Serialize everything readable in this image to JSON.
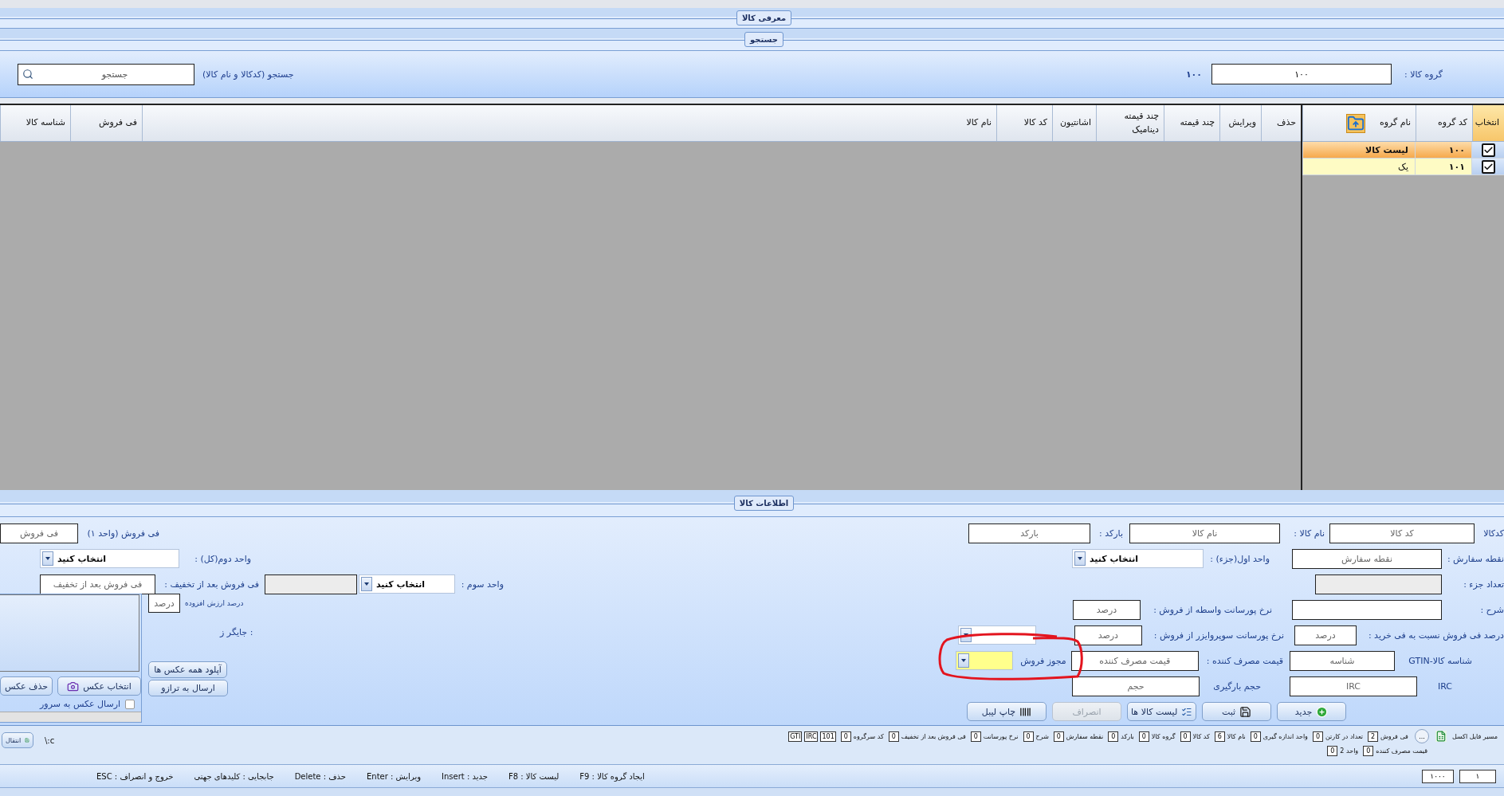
{
  "intro": {
    "legend": "معرفی کالا"
  },
  "search": {
    "legend": "جستجو",
    "group_label": "گروه کالا :",
    "group_value": "۱۰۰",
    "group_code": "۱۰۰",
    "search_label": "جستجو (کدکالا و نام کالا)",
    "search_placeholder": "جستجو"
  },
  "groups": {
    "columns": [
      "انتخاب",
      "کد گروه",
      "نام گروه"
    ],
    "rows": [
      {
        "checked": true,
        "selected": true,
        "code": "۱۰۰",
        "name": "لیست کالا"
      },
      {
        "checked": true,
        "selected": false,
        "code": "۱۰۱",
        "name": "یک"
      }
    ]
  },
  "items_table": {
    "columns": [
      "حذف",
      "ویرایش",
      "چند قیمته",
      "چند قیمته دینامیک",
      "اشانتیون",
      "کد کالا",
      "نام کالا",
      "فی فروش",
      "شناسه کالا"
    ]
  },
  "item_info": {
    "legend": "اطلاعات کالا",
    "right_rows": [
      [
        {
          "kind": "input",
          "label": "کدکالا",
          "placeholder": "کد کالا"
        },
        {
          "kind": "input",
          "label": "نام کالا :",
          "placeholder": "نام کالا"
        },
        {
          "kind": "input",
          "label": "بارکد :",
          "placeholder": "بارکد"
        }
      ],
      [
        {
          "kind": "input",
          "label": "نقطه سفارش :",
          "placeholder": "نقطه سفارش"
        },
        {
          "kind": "select",
          "label": "واحد اول(جزء) :",
          "value": "انتخاب کنید"
        }
      ],
      [
        {
          "kind": "input",
          "label": "تعداد جزء :",
          "disabled": true
        }
      ],
      [
        {
          "kind": "input",
          "label": "شرح :"
        },
        {
          "kind": "input",
          "label": "نرخ پورسانت واسطه از فروش :",
          "placeholder": "درصد"
        }
      ],
      [
        {
          "kind": "input",
          "label": "درصد فی فروش نسبت به فی خرید :",
          "placeholder": "درصد"
        },
        {
          "kind": "input",
          "label": "نرخ پورسانت سوپروایزر از فروش :",
          "placeholder": "درصد"
        },
        {
          "kind": "select"
        }
      ],
      [
        {
          "kind": "input",
          "label": "شناسه کالا-GTIN",
          "placeholder": "شناسه"
        },
        {
          "kind": "input",
          "label": "قیمت مصرف کننده :",
          "placeholder": "قیمت مصرف کننده"
        },
        {
          "kind": "select",
          "label": "مجوز فروش",
          "highlighted": true
        }
      ],
      [
        {
          "kind": "input",
          "label": "IRC",
          "placeholder": "IRC"
        },
        {
          "kind": "input",
          "label": "حجم بارگیری",
          "placeholder": "حجم"
        }
      ]
    ],
    "left_rows": [
      [
        {
          "kind": "input",
          "label": "فی فروش (واحد ۱)",
          "placeholder": "فی فروش"
        }
      ],
      [
        {
          "kind": "select",
          "label": "واحد دوم(کل) :",
          "value": "انتخاب کنید"
        }
      ],
      [
        {
          "kind": "select",
          "label": "واحد سوم :",
          "value": "انتخاب کنید"
        },
        {
          "kind": "input",
          "disabled": true
        },
        {
          "kind": "input",
          "label": "فی فروش بعد از تخفیف :",
          "placeholder": "فی فروش بعد از تخفیف"
        }
      ]
    ],
    "vat": {
      "label": "درصد ارزش افزوده",
      "placeholder": "درصد"
    },
    "printer_label": "جایگر ز :",
    "photo_buttons": [
      "انتخاب عکس",
      "حذف عکس"
    ],
    "send_photo": {
      "label": "ارسال عکس به سرور",
      "checked": false
    },
    "upload_buttons": [
      "آپلود همه عکس ها",
      "ارسال به ترازو"
    ],
    "buttons": [
      {
        "label": "جدید",
        "disabled": false
      },
      {
        "label": "ثبت",
        "disabled": false
      },
      {
        "label": "لیست کالا ها",
        "disabled": false
      },
      {
        "label": "انصراف",
        "disabled": true
      },
      {
        "label": "چاپ لیبل",
        "disabled": false
      }
    ]
  },
  "excel": {
    "label": "مسیر فایل اکسل",
    "browse": "...",
    "columns": [
      {
        "label": "فی فروش",
        "value": "2"
      },
      {
        "label": "تعداد در کارتن",
        "value": "0"
      },
      {
        "label": "واحد اندازه گیری",
        "value": "0"
      },
      {
        "label": "نام کالا",
        "value": "6"
      },
      {
        "label": "کد کالا",
        "value": "0"
      },
      {
        "label": "گروه کالا",
        "value": "0"
      },
      {
        "label": "بارکد",
        "value": "0"
      },
      {
        "label": "نقطه سفارش",
        "value": "0"
      },
      {
        "label": "شرح",
        "value": "0"
      },
      {
        "label": "نرخ پورسانت",
        "value": "0"
      },
      {
        "label": "فی فروش بعد از تخفیف",
        "value": "0"
      },
      {
        "label": "کد سرگروه",
        "value": "0"
      }
    ],
    "extra_values": [
      "101",
      "IRC",
      "GTI"
    ],
    "columns_2": [
      {
        "label": "قیمت مصرف کننده",
        "value": "0"
      },
      {
        "label": "واحد 2",
        "value": "0"
      }
    ],
    "transfer": "انتقال",
    "path": "c:\\"
  },
  "status_bar": {
    "counters": [
      "۱",
      "۱۰۰۰"
    ],
    "shortcuts": [
      "ایجاد گروه کالا : F9",
      "لیست کالا : F8",
      "جدید : Insert",
      "ویرایش : Enter",
      "حذف : Delete",
      "جابجایی : کلیدهای جهتی",
      "خروج و انصراف : ESC"
    ]
  }
}
